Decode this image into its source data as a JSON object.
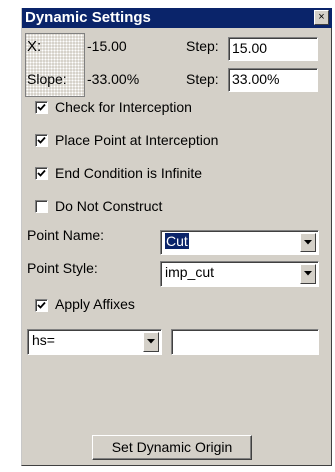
{
  "window": {
    "title": "Dynamic Settings",
    "close_symbol": "×"
  },
  "coords": {
    "x_label": "X:",
    "x_value": "-15.00",
    "x_step_label": "Step:",
    "x_step_value": "15.00",
    "slope_label": "Slope:",
    "slope_value": "-33.00%",
    "slope_step_label": "Step:",
    "slope_step_value": "33.00%"
  },
  "options": [
    {
      "label": "Check for Interception",
      "checked": true
    },
    {
      "label": "Place Point at Interception",
      "checked": true
    },
    {
      "label": "End Condition is Infinite",
      "checked": true
    },
    {
      "label": "Do Not Construct",
      "checked": false
    }
  ],
  "point_name": {
    "label": "Point Name:",
    "value": "Cut"
  },
  "point_style": {
    "label": "Point Style:",
    "value": "imp_cut"
  },
  "affixes": {
    "label": "Apply Affixes",
    "checked": true,
    "prefix": "hs=",
    "text": ""
  },
  "origin_button": "Set Dynamic Origin",
  "icons": {
    "dropdown": "chevron-down-icon",
    "check": "checkmark-icon",
    "close": "close-icon"
  }
}
